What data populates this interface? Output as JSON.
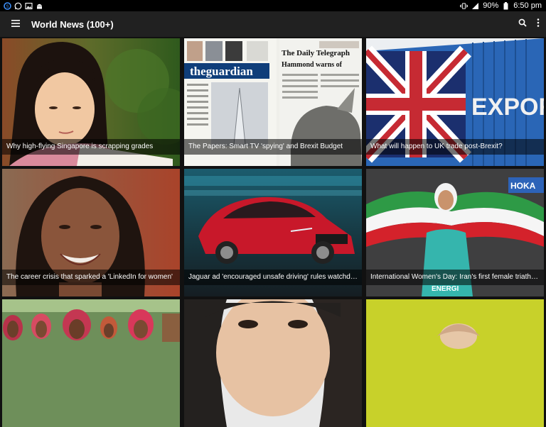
{
  "status_bar": {
    "battery": "90%",
    "time": "6:50 pm",
    "icons": [
      "sync-icon",
      "whatsapp-icon",
      "image-notification-icon",
      "android-icon",
      "vibrate-icon",
      "signal-icon",
      "battery-icon"
    ]
  },
  "app_bar": {
    "title": "World News (100+)",
    "icons": [
      "menu-icon",
      "search-icon",
      "more-options-icon"
    ]
  },
  "news": {
    "items": [
      {
        "title": "Why high-flying Singapore is scrapping grades"
      },
      {
        "title": "The Papers: Smart TV 'spying' and Brexit Budget"
      },
      {
        "title": "What will happen to UK trade post-Brexit?"
      },
      {
        "title": "The career crisis that sparked a 'LinkedIn for women'"
      },
      {
        "title": "Jaguar ad 'encouraged unsafe driving' rules watchdog"
      },
      {
        "title": "International Women's Day: Iran's first female triathlete"
      },
      {
        "title": ""
      },
      {
        "title": ""
      },
      {
        "title": ""
      }
    ]
  },
  "image_text": {
    "guardian": "theguardian",
    "telegraph": "The Daily Telegraph",
    "telegraph_headline": "Hammond warns of",
    "export": "EXPORT",
    "hoka": "HOKA",
    "energi": "ENERGI"
  }
}
